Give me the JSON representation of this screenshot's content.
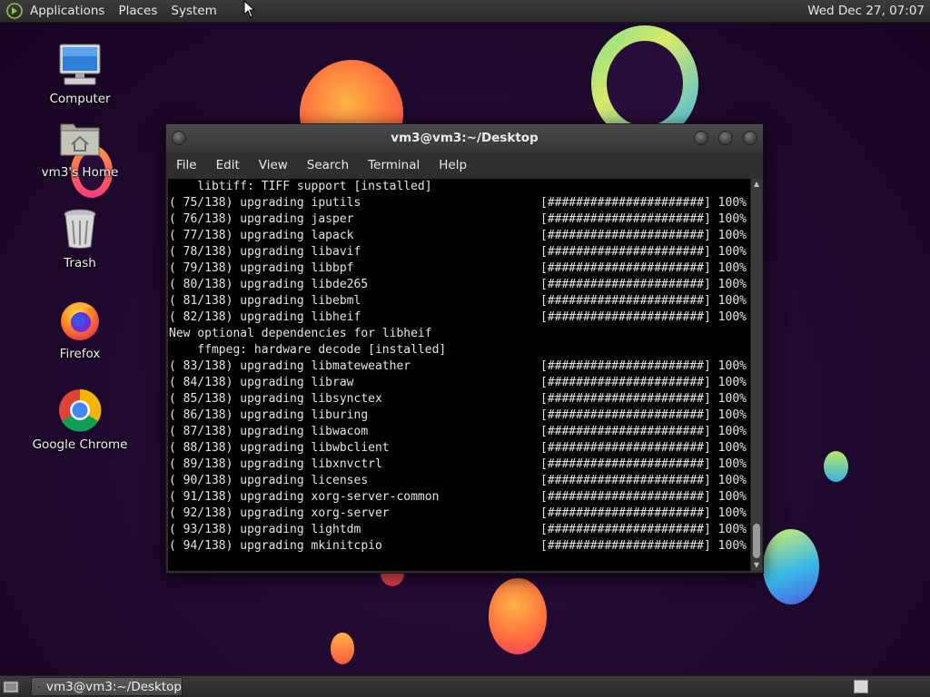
{
  "top_panel": {
    "menus": [
      "Applications",
      "Places",
      "System"
    ],
    "clock": "Wed Dec 27, 07:07"
  },
  "desktop_icons": [
    {
      "label": "Computer",
      "icon": "computer-icon"
    },
    {
      "label": "vm3's Home",
      "icon": "home-folder-icon"
    },
    {
      "label": "Trash",
      "icon": "trash-icon"
    },
    {
      "label": "Firefox",
      "icon": "firefox-icon"
    },
    {
      "label": "Google Chrome",
      "icon": "chrome-icon"
    }
  ],
  "terminal": {
    "title": "vm3@vm3:~/Desktop",
    "menu": [
      "File",
      "Edit",
      "View",
      "Search",
      "Terminal",
      "Help"
    ],
    "lines": [
      {
        "text": "    libtiff: TIFF support [installed]",
        "bar": ""
      },
      {
        "text": "( 75/138) upgrading iputils",
        "bar": "[######################] 100%"
      },
      {
        "text": "( 76/138) upgrading jasper",
        "bar": "[######################] 100%"
      },
      {
        "text": "( 77/138) upgrading lapack",
        "bar": "[######################] 100%"
      },
      {
        "text": "( 78/138) upgrading libavif",
        "bar": "[######################] 100%"
      },
      {
        "text": "( 79/138) upgrading libbpf",
        "bar": "[######################] 100%"
      },
      {
        "text": "( 80/138) upgrading libde265",
        "bar": "[######################] 100%"
      },
      {
        "text": "( 81/138) upgrading libebml",
        "bar": "[######################] 100%"
      },
      {
        "text": "( 82/138) upgrading libheif",
        "bar": "[######################] 100%"
      },
      {
        "text": "New optional dependencies for libheif",
        "bar": ""
      },
      {
        "text": "    ffmpeg: hardware decode [installed]",
        "bar": ""
      },
      {
        "text": "( 83/138) upgrading libmateweather",
        "bar": "[######################] 100%"
      },
      {
        "text": "( 84/138) upgrading libraw",
        "bar": "[######################] 100%"
      },
      {
        "text": "( 85/138) upgrading libsynctex",
        "bar": "[######################] 100%"
      },
      {
        "text": "( 86/138) upgrading liburing",
        "bar": "[######################] 100%"
      },
      {
        "text": "( 87/138) upgrading libwacom",
        "bar": "[######################] 100%"
      },
      {
        "text": "( 88/138) upgrading libwbclient",
        "bar": "[######################] 100%"
      },
      {
        "text": "( 89/138) upgrading libxnvctrl",
        "bar": "[######################] 100%"
      },
      {
        "text": "( 90/138) upgrading licenses",
        "bar": "[######################] 100%"
      },
      {
        "text": "( 91/138) upgrading xorg-server-common",
        "bar": "[######################] 100%"
      },
      {
        "text": "( 92/138) upgrading xorg-server",
        "bar": "[######################] 100%"
      },
      {
        "text": "( 93/138) upgrading lightdm",
        "bar": "[######################] 100%"
      },
      {
        "text": "( 94/138) upgrading mkinitcpio",
        "bar": "[######################] 100%"
      }
    ]
  },
  "taskbar": {
    "task_label": "vm3@vm3:~/Desktop"
  }
}
